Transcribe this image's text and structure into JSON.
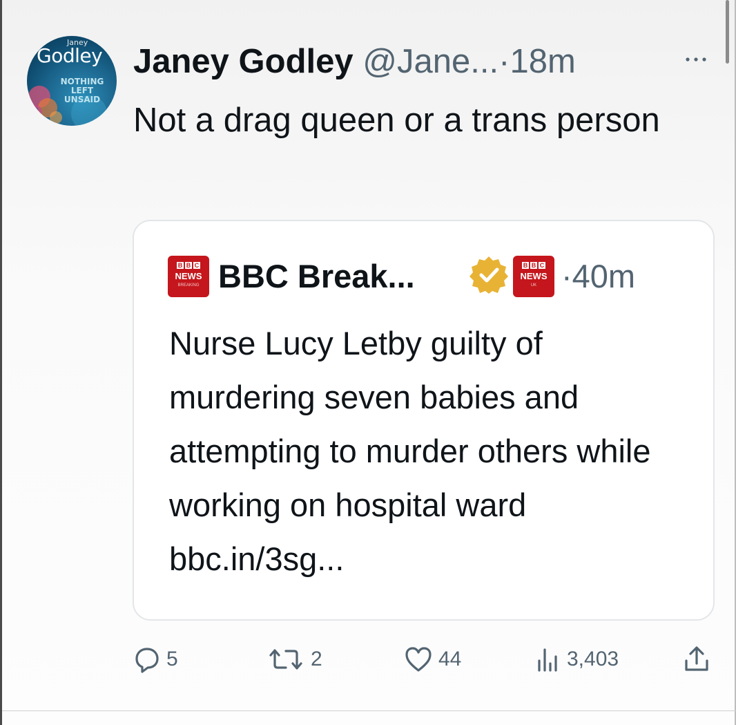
{
  "tweet": {
    "author_name": "Janey Godley",
    "author_handle": "@Jane...",
    "separator": "·",
    "time": "18m",
    "text": "Not a drag queen or a trans person",
    "avatar": {
      "logo_small": "Janey",
      "logo_big": "Godley",
      "subtitle_lines": [
        "NOTHING",
        "LEFT",
        "UNSAID"
      ]
    },
    "more_icon": "more-horizontal-icon"
  },
  "quote": {
    "logo_left": {
      "blocks": [
        "B",
        "B",
        "C"
      ],
      "label": "NEWS",
      "sub": "BREAKING"
    },
    "author_name": "BBC Break...",
    "verified_icon": "gold-verified-badge-icon",
    "logo_right": {
      "blocks": [
        "B",
        "B",
        "C"
      ],
      "label": "NEWS",
      "sub": "UK"
    },
    "separator": "·",
    "time": "40m",
    "text": "Nurse Lucy Letby guilty of murdering seven babies and attempting to murder others while working on hospital ward bbc.in/3sg..."
  },
  "actions": {
    "replies": {
      "icon": "reply-icon",
      "count": "5"
    },
    "reposts": {
      "icon": "repost-icon",
      "count": "2"
    },
    "likes": {
      "icon": "heart-icon",
      "count": "44"
    },
    "views": {
      "icon": "views-chart-icon",
      "count": "3,403"
    },
    "share": {
      "icon": "share-icon"
    }
  },
  "colors": {
    "text_primary": "#0f1419",
    "text_secondary": "#536471",
    "bbc_red": "#c4161c",
    "verified_gold": "#e8b335",
    "card_border": "#e3e6e9"
  }
}
